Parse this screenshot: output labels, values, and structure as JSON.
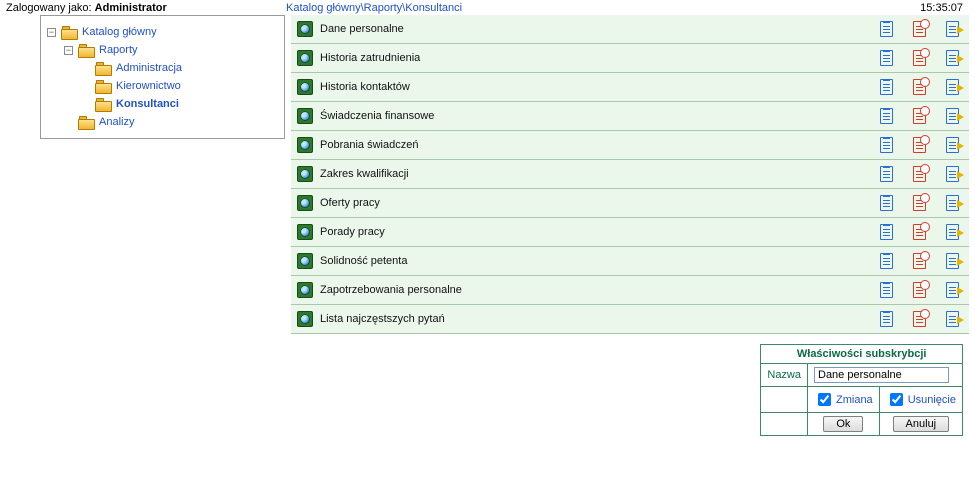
{
  "header": {
    "logged_in_as_label": "Zalogowany jako:",
    "user": "Administrator",
    "breadcrumb": "Katalog główny\\Raporty\\Konsultanci",
    "time": "15:35:07"
  },
  "tree": [
    {
      "indent": 0,
      "toggle": "−",
      "label": "Katalog główny",
      "bold": false
    },
    {
      "indent": 1,
      "toggle": "−",
      "label": "Raporty",
      "bold": false
    },
    {
      "indent": 2,
      "toggle": "",
      "label": "Administracja",
      "bold": false
    },
    {
      "indent": 2,
      "toggle": "",
      "label": "Kierownictwo",
      "bold": false
    },
    {
      "indent": 2,
      "toggle": "",
      "label": "Konsultanci",
      "bold": true
    },
    {
      "indent": 1,
      "toggle": "",
      "label": "Analizy",
      "bold": false
    }
  ],
  "reports": [
    "Dane personalne",
    "Historia zatrudnienia",
    "Historia kontaktów",
    "Świadczenia finansowe",
    "Pobrania świadczeń",
    "Zakres kwalifikacji",
    "Oferty pracy",
    "Porady pracy",
    "Solidność petenta",
    "Zapotrzebowania personalne",
    "Lista najczęstszych pytań"
  ],
  "props": {
    "title": "Właściwości subskrybcji",
    "name_label": "Nazwa",
    "name_value": "Dane personalne",
    "change_checked": true,
    "change_label": "Zmiana",
    "delete_checked": true,
    "delete_label": "Usunięcie",
    "ok_label": "Ok",
    "cancel_label": "Anuluj"
  }
}
